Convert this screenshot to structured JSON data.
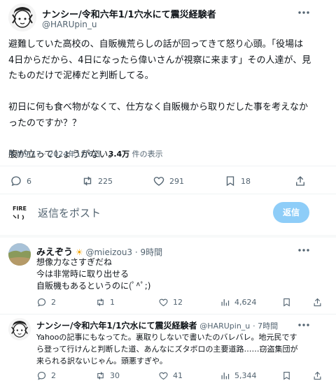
{
  "main_post": {
    "display_name": "ナンシー/令和六年1/1穴水にて震災経験者",
    "handle": "@HARUpin_u",
    "body": [
      "避難していた高校の、自販機荒らしの話が回ってきて怒り心頭。「役場は",
      "4日からだから、4日になったら偉いさんが視察に来ます」その人達が、見",
      "たものだけで泥棒だと判断してる。",
      "",
      "初日に何も食べ物がなくて、仕方なく自販機から取りだした事を考えなか",
      "ったのですか？？",
      "",
      "腹が立ってしょうがない。"
    ],
    "timestamp": "午前9:17 · 2024年1月6日 · ",
    "views_count": "3.4万",
    "views_label": " 件の表示",
    "stats": {
      "replies": "6",
      "reposts": "225",
      "likes": "291",
      "bookmarks": "18"
    }
  },
  "reply_composer": {
    "avatar_text": "FIRE",
    "placeholder": "返信をポスト",
    "button_label": "返信"
  },
  "replies": [
    {
      "display_name": "みえぞう",
      "emoji": "☀",
      "handle": "@mieizou3",
      "time": "· 9時間",
      "lines": [
        "想像力なさすぎだね",
        "今は非常時に取り出せる",
        "自販機もあるというのに(ﾟ^ﾟ;)"
      ],
      "stats": {
        "replies": "2",
        "reposts": "1",
        "likes": "12",
        "views": "4,624"
      }
    },
    {
      "display_name": "ナンシー/令和六年1/1穴水にて震災経験者",
      "handle": "@HARUpin_u",
      "time": "· 7時間",
      "lines": [
        "Yahooの記事にもなってた。裏取りしないで書いたのバレバレ。地元民です",
        "ら登って行けんと判断した道、あんなにズタボロの主要道路……窃盗集団が",
        "来られる訳ないじゃん。頭悪すぎや。"
      ],
      "stats": {
        "replies": "2",
        "reposts": "30",
        "likes": "41",
        "views": "5,344"
      }
    }
  ],
  "colors": {
    "accent_disabled": "#8ecdf8",
    "muted": "#536471",
    "divider": "#eff3f4"
  }
}
